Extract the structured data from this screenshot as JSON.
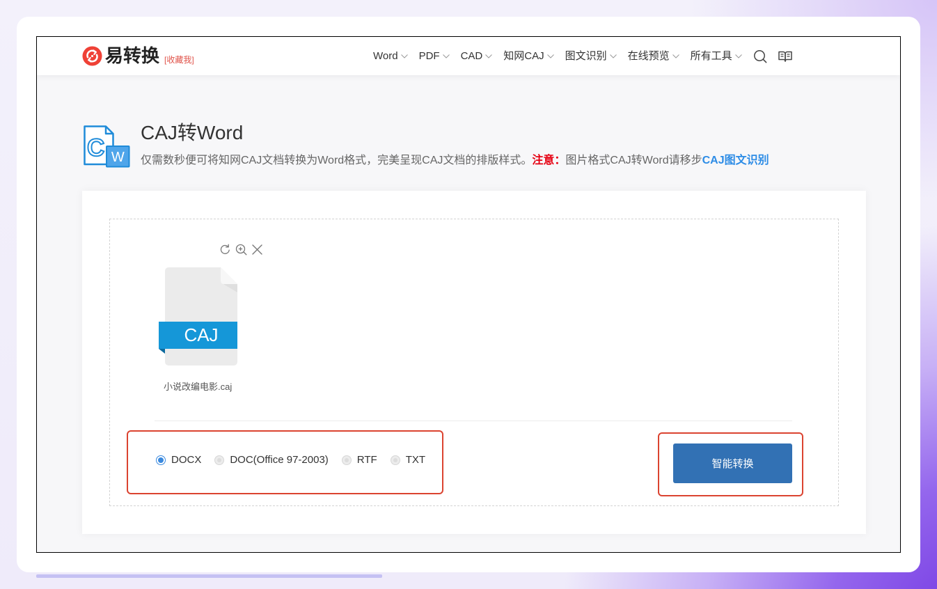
{
  "colors": {
    "brand_red": "#ef4136",
    "note_red": "#e60012",
    "link_blue": "#2d8ce6",
    "primary_button": "#3271b4",
    "radio_selected": "#3a89de",
    "file_banner": "#1597d8",
    "annotation_red": "#db4330",
    "hero_icon_blue": "#1f8bd9"
  },
  "header": {
    "logo_icon": "refresh-circle-icon",
    "logo_text": "易转换",
    "bookmark_label": "[收藏我]",
    "nav": [
      {
        "label": "Word",
        "icon": "chevron-down-icon"
      },
      {
        "label": "PDF",
        "icon": "chevron-down-icon"
      },
      {
        "label": "CAD",
        "icon": "chevron-down-icon"
      },
      {
        "label": "知网CAJ",
        "icon": "chevron-down-icon"
      },
      {
        "label": "图文识别",
        "icon": "chevron-down-icon"
      },
      {
        "label": "在线预览",
        "icon": "chevron-down-icon"
      },
      {
        "label": "所有工具",
        "icon": "chevron-down-icon"
      }
    ],
    "search_icon": "search-icon",
    "book_icon": "open-book-icon"
  },
  "hero": {
    "icon": "caj-to-word-icon",
    "icon_letters": {
      "source": "C",
      "target": "W"
    },
    "title": "CAJ转Word",
    "description": "仅需数秒便可将知网CAJ文档转换为Word格式，完美呈现CAJ文档的排版样式。",
    "note_label": "注意：",
    "note_text": "图片格式CAJ转Word请移步",
    "note_link": "CAJ图文识别"
  },
  "uploader": {
    "file": {
      "type_badge": "CAJ",
      "name": "小说改编电影.caj",
      "actions": [
        {
          "icon": "rotate-icon"
        },
        {
          "icon": "zoom-in-icon"
        },
        {
          "icon": "close-icon"
        }
      ]
    },
    "output_formats": [
      {
        "label": "DOCX",
        "selected": true
      },
      {
        "label": "DOC(Office 97-2003)",
        "selected": false
      },
      {
        "label": "RTF",
        "selected": false
      },
      {
        "label": "TXT",
        "selected": false
      }
    ],
    "convert_button": "智能转换"
  }
}
